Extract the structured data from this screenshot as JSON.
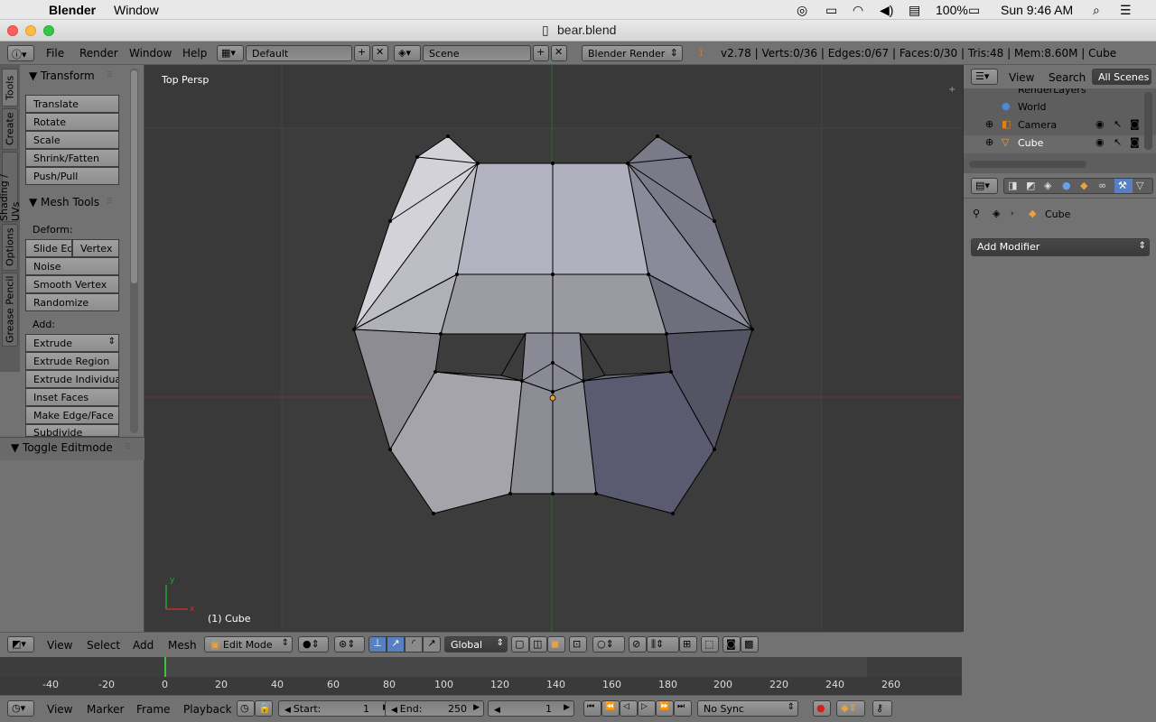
{
  "mac_menu": {
    "app_name": "Blender",
    "window_menu": "Window",
    "battery": "100%",
    "clock": "Sun 9:46 AM"
  },
  "window": {
    "title": "bear.blend"
  },
  "top_header": {
    "menus": [
      "File",
      "Render",
      "Window",
      "Help"
    ],
    "layout": "Default",
    "scene": "Scene",
    "engine": "Blender Render",
    "stats": "v2.78 | Verts:0/36 | Edges:0/67 | Faces:0/30 | Tris:48 | Mem:8.60M | Cube"
  },
  "tool_tabs": [
    "Tools",
    "Create",
    "Shading / UVs",
    "Options",
    "Grease Pencil"
  ],
  "tool_shelf": {
    "transform_title": "Transform",
    "transform_buttons": [
      "Translate",
      "Rotate",
      "Scale",
      "Shrink/Fatten",
      "Push/Pull"
    ],
    "mesh_tools_title": "Mesh Tools",
    "deform_label": "Deform:",
    "slide_edge": "Slide Ed",
    "vertex": "Vertex",
    "noise": "Noise",
    "smooth_vertex": "Smooth Vertex",
    "randomize": "Randomize",
    "add_label": "Add:",
    "extrude": "Extrude",
    "add_buttons": [
      "Extrude Region",
      "Extrude Individual",
      "Inset Faces",
      "Make Edge/Face",
      "Subdivide"
    ],
    "toggle_editmode": "Toggle Editmode"
  },
  "viewport": {
    "view_name": "Top Persp",
    "object_label": "(1) Cube",
    "axis_y": "y",
    "axis_x": "x"
  },
  "outliner": {
    "menus": [
      "View",
      "Search"
    ],
    "scope": "All Scenes",
    "items": [
      "RenderLayers",
      "World",
      "Camera",
      "Cube"
    ]
  },
  "properties": {
    "object_name": "Cube",
    "add_modifier": "Add Modifier"
  },
  "view3d_header": {
    "menus": [
      "View",
      "Select",
      "Add",
      "Mesh"
    ],
    "mode": "Edit Mode",
    "orientation": "Global"
  },
  "timeline": {
    "ticks": [
      "-40",
      "-20",
      "0",
      "20",
      "40",
      "60",
      "80",
      "100",
      "120",
      "140",
      "160",
      "180",
      "200",
      "220",
      "240",
      "260"
    ]
  },
  "timeline_header": {
    "menus": [
      "View",
      "Marker",
      "Frame",
      "Playback"
    ],
    "start_label": "Start:",
    "start_value": "1",
    "end_label": "End:",
    "end_value": "250",
    "current_frame": "1",
    "sync": "No Sync"
  }
}
